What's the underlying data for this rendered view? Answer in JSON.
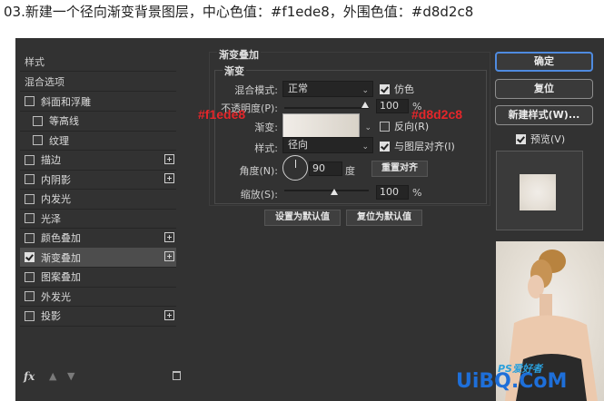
{
  "caption": "03.新建一个径向渐变背景图层，中心色值：#f1ede8，外围色值：#d8d2c8",
  "colors": {
    "center": "#f1ede8",
    "outer": "#d8d2c8",
    "dialog_bg": "#323232",
    "accent": "#4f8be0",
    "annotation": "#e5262a"
  },
  "styles_panel": {
    "header": "样式",
    "blend_options": "混合选项",
    "items": [
      {
        "label": "斜面和浮雕",
        "checked": false,
        "indent": 0,
        "plus": false
      },
      {
        "label": "等高线",
        "checked": false,
        "indent": 1,
        "plus": false
      },
      {
        "label": "纹理",
        "checked": false,
        "indent": 1,
        "plus": false
      },
      {
        "label": "描边",
        "checked": false,
        "indent": 0,
        "plus": true
      },
      {
        "label": "内阴影",
        "checked": false,
        "indent": 0,
        "plus": true
      },
      {
        "label": "内发光",
        "checked": false,
        "indent": 0,
        "plus": false
      },
      {
        "label": "光泽",
        "checked": false,
        "indent": 0,
        "plus": false
      },
      {
        "label": "颜色叠加",
        "checked": false,
        "indent": 0,
        "plus": true
      },
      {
        "label": "渐变叠加",
        "checked": true,
        "indent": 0,
        "plus": true,
        "active": true
      },
      {
        "label": "图案叠加",
        "checked": false,
        "indent": 0,
        "plus": false
      },
      {
        "label": "外发光",
        "checked": false,
        "indent": 0,
        "plus": false
      },
      {
        "label": "投影",
        "checked": false,
        "indent": 0,
        "plus": true
      }
    ],
    "fx": "fx"
  },
  "gradient_overlay": {
    "section_title": "渐变叠加",
    "group_title": "渐变",
    "blend_mode_label": "混合模式:",
    "blend_mode_value": "正常",
    "dither_label": "仿色",
    "dither_checked": true,
    "opacity_label": "不透明度(P):",
    "opacity_value": "100",
    "opacity_unit": "%",
    "gradient_label": "渐变:",
    "reverse_label": "反向(R)",
    "reverse_checked": false,
    "style_label": "样式:",
    "style_value": "径向",
    "align_label": "与图层对齐(I)",
    "align_checked": true,
    "angle_label": "角度(N):",
    "angle_value": "90",
    "angle_unit": "度",
    "reset_align_label": "重置对齐",
    "scale_label": "缩放(S):",
    "scale_value": "100",
    "scale_unit": "%",
    "set_default_label": "设置为默认值",
    "reset_default_label": "复位为默认值",
    "annotation_left": "#f1ede8",
    "annotation_right": "#d8d2c8"
  },
  "right_panel": {
    "ok_label": "确定",
    "reset_label": "复位",
    "new_style_label": "新建样式(W)...",
    "preview_label": "预览(V)",
    "preview_checked": true
  },
  "watermark": {
    "brand": "UiBQ.CoM",
    "ps_text": "PS爱好者"
  }
}
